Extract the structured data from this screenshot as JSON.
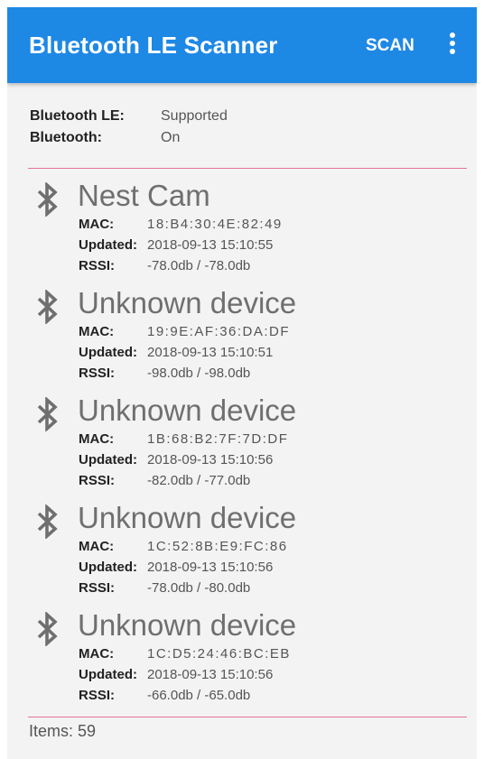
{
  "appbar": {
    "title": "Bluetooth LE Scanner",
    "scan_label": "SCAN",
    "background": "#1e88e5"
  },
  "status": [
    {
      "label": "Bluetooth LE:",
      "value": "Supported"
    },
    {
      "label": "Bluetooth:",
      "value": "On"
    }
  ],
  "field_labels": {
    "mac": "MAC:",
    "updated": "Updated:",
    "rssi": "RSSI:"
  },
  "devices": [
    {
      "name": "Nest Cam",
      "mac": "18:B4:30:4E:82:49",
      "updated": "2018-09-13 15:10:55",
      "rssi": "-78.0db / -78.0db",
      "icon": "bluetooth-icon"
    },
    {
      "name": "Unknown device",
      "mac": "19:9E:AF:36:DA:DF",
      "updated": "2018-09-13 15:10:51",
      "rssi": "-98.0db / -98.0db",
      "icon": "bluetooth-icon"
    },
    {
      "name": "Unknown device",
      "mac": "1B:68:B2:7F:7D:DF",
      "updated": "2018-09-13 15:10:56",
      "rssi": "-82.0db / -77.0db",
      "icon": "bluetooth-icon"
    },
    {
      "name": "Unknown device",
      "mac": "1C:52:8B:E9:FC:86",
      "updated": "2018-09-13 15:10:56",
      "rssi": "-78.0db / -80.0db",
      "icon": "bluetooth-icon"
    },
    {
      "name": "Unknown device",
      "mac": "1C:D5:24:46:BC:EB",
      "updated": "2018-09-13 15:10:56",
      "rssi": "-66.0db / -65.0db",
      "icon": "bluetooth-icon"
    }
  ],
  "footer": {
    "items_text": "Items: 59"
  },
  "colors": {
    "accent": "#1e88e5",
    "divider": "#e57595",
    "background": "#f3f3f3"
  }
}
